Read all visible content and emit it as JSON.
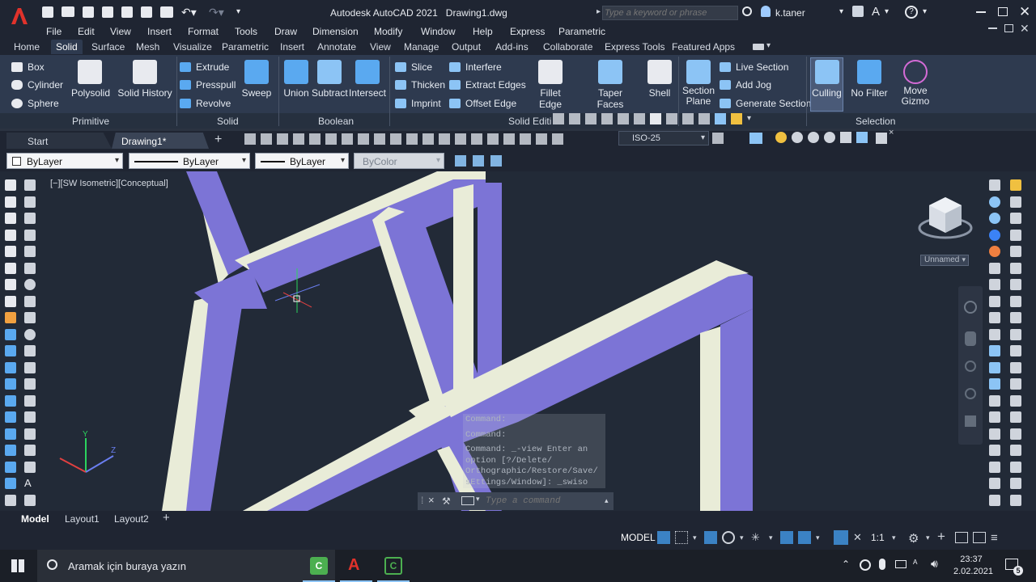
{
  "title": {
    "app": "Autodesk AutoCAD 2021",
    "doc": "Drawing1.dwg",
    "search_placeholder": "Type a keyword or phrase",
    "user": "k.taner"
  },
  "menu": [
    "File",
    "Edit",
    "View",
    "Insert",
    "Format",
    "Tools",
    "Draw",
    "Dimension",
    "Modify",
    "Window",
    "Help",
    "Express",
    "Parametric"
  ],
  "ribbon_tabs": [
    "Home",
    "Solid",
    "Surface",
    "Mesh",
    "Visualize",
    "Parametric",
    "Insert",
    "Annotate",
    "View",
    "Manage",
    "Output",
    "Add-ins",
    "Collaborate",
    "Express Tools",
    "Featured Apps"
  ],
  "active_tab": "Solid",
  "ribbon": {
    "primitive": {
      "label": "Primitive",
      "box": "Box",
      "cylinder": "Cylinder",
      "sphere": "Sphere",
      "polysolid": "Polysolid"
    },
    "solid": {
      "label": "Solid",
      "history": "Solid History",
      "extrude": "Extrude",
      "presspull": "Presspull",
      "revolve": "Revolve",
      "sweep": "Sweep"
    },
    "boolean": {
      "label": "Boolean",
      "union": "Union",
      "subtract": "Subtract",
      "intersect": "Intersect"
    },
    "solid_editing": {
      "label": "Solid Editi",
      "slice": "Slice",
      "thicken": "Thicken",
      "imprint": "Imprint",
      "interfere": "Interfere",
      "extract_edges": "Extract Edges",
      "offset_edge": "Offset Edge",
      "fillet_edge": "Fillet Edge",
      "taper_faces": "Taper Faces",
      "shell": "Shell"
    },
    "section": {
      "section_plane_1": "Section",
      "section_plane_2": "Plane",
      "live_section": "Live Section",
      "add_jog": "Add Jog",
      "generate_section": "Generate Section"
    },
    "selection": {
      "label": "Selection",
      "culling": "Culling",
      "no_filter": "No Filter",
      "move_gizmo_1": "Move",
      "move_gizmo_2": "Gizmo"
    }
  },
  "doc_tabs": {
    "start": "Start",
    "drawing": "Drawing1*"
  },
  "dimstyle": "ISO-25",
  "properties": {
    "layer": "ByLayer",
    "linetype": "ByLayer",
    "lineweight": "ByLayer",
    "color": "ByColor"
  },
  "viewport": {
    "label": "[−][SW Isometric][Conceptual]",
    "viewcube_name": "Unnamed"
  },
  "command": {
    "history": [
      "Command:",
      "Command:",
      "Command: _-view Enter an",
      "option [?/Delete/",
      "Orthographic/Restore/Save/",
      "sEttings/Window]: _swiso"
    ],
    "placeholder": "Type a command"
  },
  "layout_tabs": [
    "Model",
    "Layout1",
    "Layout2"
  ],
  "status": {
    "model": "MODEL",
    "scale": "1:1"
  },
  "taskbar": {
    "search_placeholder": "Aramak için buraya yazın",
    "time": "23:37",
    "date": "2.02.2021"
  },
  "colors": {
    "accent": "#3b82c4",
    "solid_fill": "#7c74d6",
    "edge_fill": "#e9ecd8",
    "viewport_bg": "#222a37"
  }
}
